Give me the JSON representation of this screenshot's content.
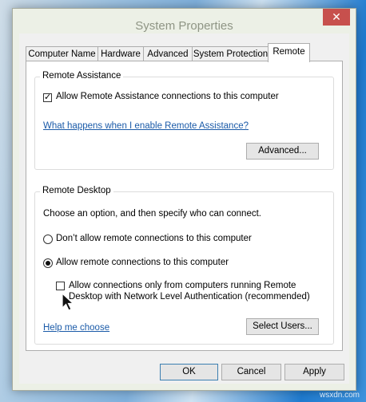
{
  "window": {
    "title": "System Properties",
    "close_label": "✕"
  },
  "tabs": [
    {
      "label": "Computer Name",
      "active": false
    },
    {
      "label": "Hardware",
      "active": false
    },
    {
      "label": "Advanced",
      "active": false
    },
    {
      "label": "System Protection",
      "active": false
    },
    {
      "label": "Remote",
      "active": true
    }
  ],
  "remote_assistance": {
    "group_label": "Remote Assistance",
    "allow_checkbox_label": "Allow Remote Assistance connections to this computer",
    "allow_checked": true,
    "help_link": "What happens when I enable Remote Assistance?",
    "advanced_button": "Advanced..."
  },
  "remote_desktop": {
    "group_label": "Remote Desktop",
    "instruction": "Choose an option, and then specify who can connect.",
    "option_dont_allow": "Don’t allow remote connections to this computer",
    "option_allow": "Allow remote connections to this computer",
    "selected_option": "allow",
    "nla_checkbox_line1": "Allow connections only from computers running Remote",
    "nla_checkbox_line2": "Desktop with Network Level Authentication (recommended)",
    "nla_checked": false,
    "help_link": "Help me choose",
    "select_users_button": "Select Users..."
  },
  "footer": {
    "ok_button": "OK",
    "cancel_button": "Cancel",
    "apply_button": "Apply"
  },
  "watermark": "wsxdn.com",
  "icons": {
    "check": "✓",
    "cursor": "arrow-cursor"
  },
  "colors": {
    "link": "#1a5aa8",
    "close_button": "#c7504d",
    "frame": "#ecf0e6"
  }
}
